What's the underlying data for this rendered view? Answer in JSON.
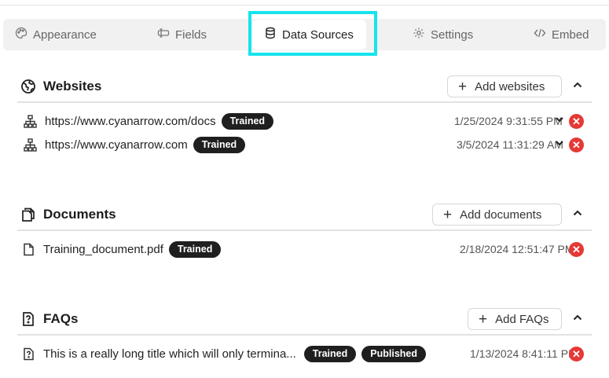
{
  "tabs": [
    {
      "label": "Appearance",
      "icon": "palette-icon"
    },
    {
      "label": "Fields",
      "icon": "fields-icon"
    },
    {
      "label": "Data Sources",
      "icon": "database-icon",
      "active": true
    },
    {
      "label": "Settings",
      "icon": "gear-icon"
    },
    {
      "label": "Embed",
      "icon": "code-icon"
    }
  ],
  "colors": {
    "active_tab_highlight": "#16e4ee",
    "badge_bg": "#1f1f1f",
    "delete": "#e53935"
  },
  "websites": {
    "title": "Websites",
    "add_label": "Add websites",
    "items": [
      {
        "title": "https://www.cyanarrow.com/docs",
        "badges": [
          "Trained"
        ],
        "date": "1/25/2024 9:31:55 PM"
      },
      {
        "title": "https://www.cyanarrow.com",
        "badges": [
          "Trained"
        ],
        "date": "3/5/2024 11:31:29 AM"
      }
    ]
  },
  "documents": {
    "title": "Documents",
    "add_label": "Add documents",
    "items": [
      {
        "title": "Training_document.pdf",
        "badges": [
          "Trained"
        ],
        "date": "2/18/2024 12:51:47 PM"
      }
    ]
  },
  "faqs": {
    "title": "FAQs",
    "add_label": "Add FAQs",
    "items": [
      {
        "title": "This is a really long title which will only termina...",
        "badges": [
          "Trained",
          "Published"
        ],
        "date": "1/13/2024 8:41:11 PM"
      }
    ]
  }
}
